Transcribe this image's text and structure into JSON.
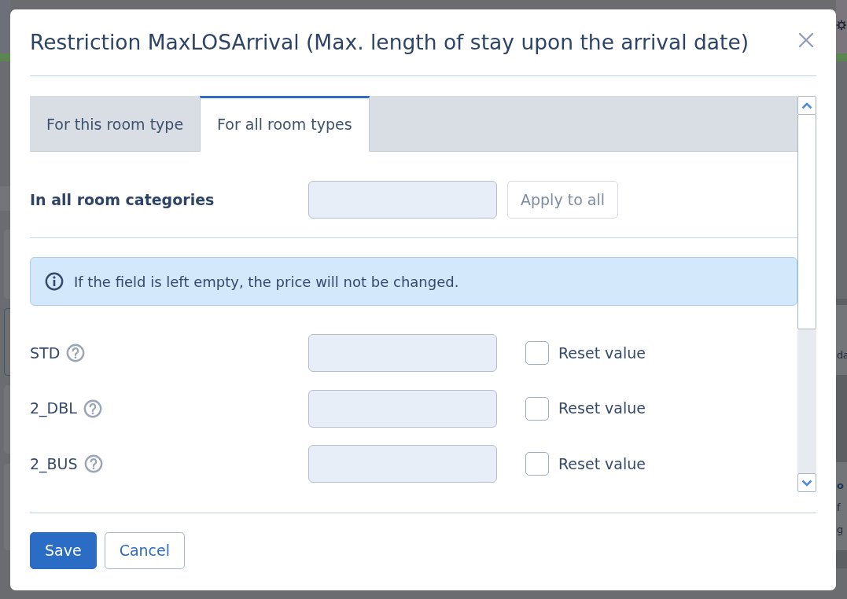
{
  "background": {
    "panels": [
      {
        "lines": [
          {
            "text": "da",
            "kind": "plain"
          }
        ]
      },
      {
        "lines": [
          {
            "text": "o",
            "kind": "heading"
          },
          {
            "text": "f",
            "kind": "plain"
          },
          {
            "text": "g",
            "kind": "plain"
          }
        ]
      }
    ]
  },
  "dialog": {
    "title": "Restriction MaxLOSArrival (Max. length of stay upon the arrival date)",
    "tabs": [
      {
        "label": "For this room type",
        "selected": false
      },
      {
        "label": "For all room types",
        "selected": true
      }
    ],
    "bulk": {
      "label": "In all room categories",
      "button": "Apply to all"
    },
    "notice": "If the field is left empty, the price will not be changed.",
    "rooms": [
      {
        "name": "STD",
        "reset_label": "Reset value",
        "checked": false
      },
      {
        "name": "2_DBL",
        "reset_label": "Reset value",
        "checked": false
      },
      {
        "name": "2_BUS",
        "reset_label": "Reset value",
        "checked": false
      }
    ],
    "buttons": [
      {
        "label": "Save",
        "kind": "primary"
      },
      {
        "label": "Cancel",
        "kind": "secondary"
      }
    ]
  }
}
